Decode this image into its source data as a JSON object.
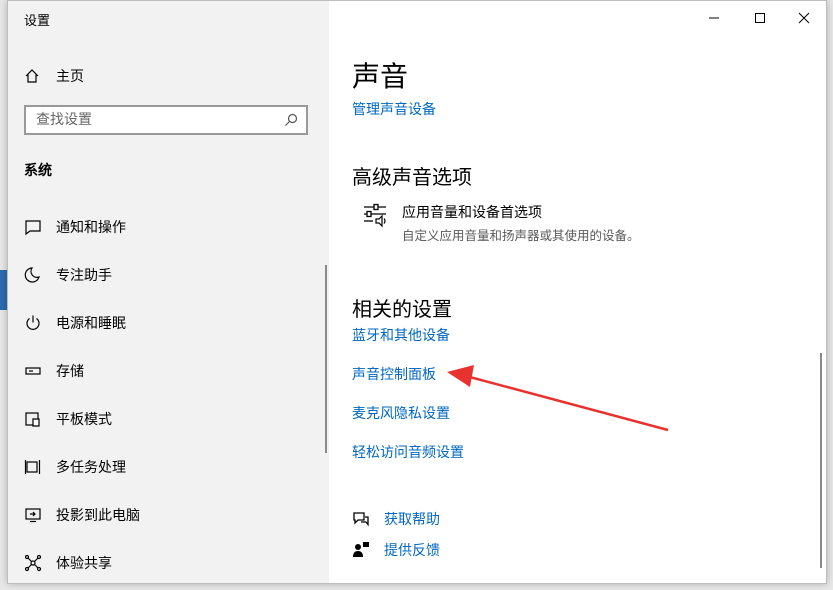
{
  "window": {
    "title": "设置"
  },
  "sidebar": {
    "home_label": "主页",
    "search_placeholder": "查找设置",
    "section_label": "系统",
    "items": [
      {
        "label": "通知和操作",
        "icon": "notification-icon"
      },
      {
        "label": "专注助手",
        "icon": "moon-icon"
      },
      {
        "label": "电源和睡眠",
        "icon": "power-icon"
      },
      {
        "label": "存储",
        "icon": "storage-icon"
      },
      {
        "label": "平板模式",
        "icon": "tablet-icon"
      },
      {
        "label": "多任务处理",
        "icon": "multitask-icon"
      },
      {
        "label": "投影到此电脑",
        "icon": "project-icon"
      },
      {
        "label": "体验共享",
        "icon": "share-icon"
      }
    ]
  },
  "main": {
    "title": "声音",
    "manage_devices_link": "管理声音设备",
    "advanced": {
      "heading": "高级声音选项",
      "pref_title": "应用音量和设备首选项",
      "pref_desc": "自定义应用音量和扬声器或其使用的设备。"
    },
    "related": {
      "heading": "相关的设置",
      "links": [
        "蓝牙和其他设备",
        "声音控制面板",
        "麦克风隐私设置",
        "轻松访问音频设置"
      ]
    },
    "help": {
      "get_help": "获取帮助",
      "feedback": "提供反馈"
    }
  },
  "annotation": {
    "arrow_color": "#e8322f"
  },
  "colors": {
    "link": "#0067c0",
    "sidebar_bg": "#f2f2f2"
  }
}
